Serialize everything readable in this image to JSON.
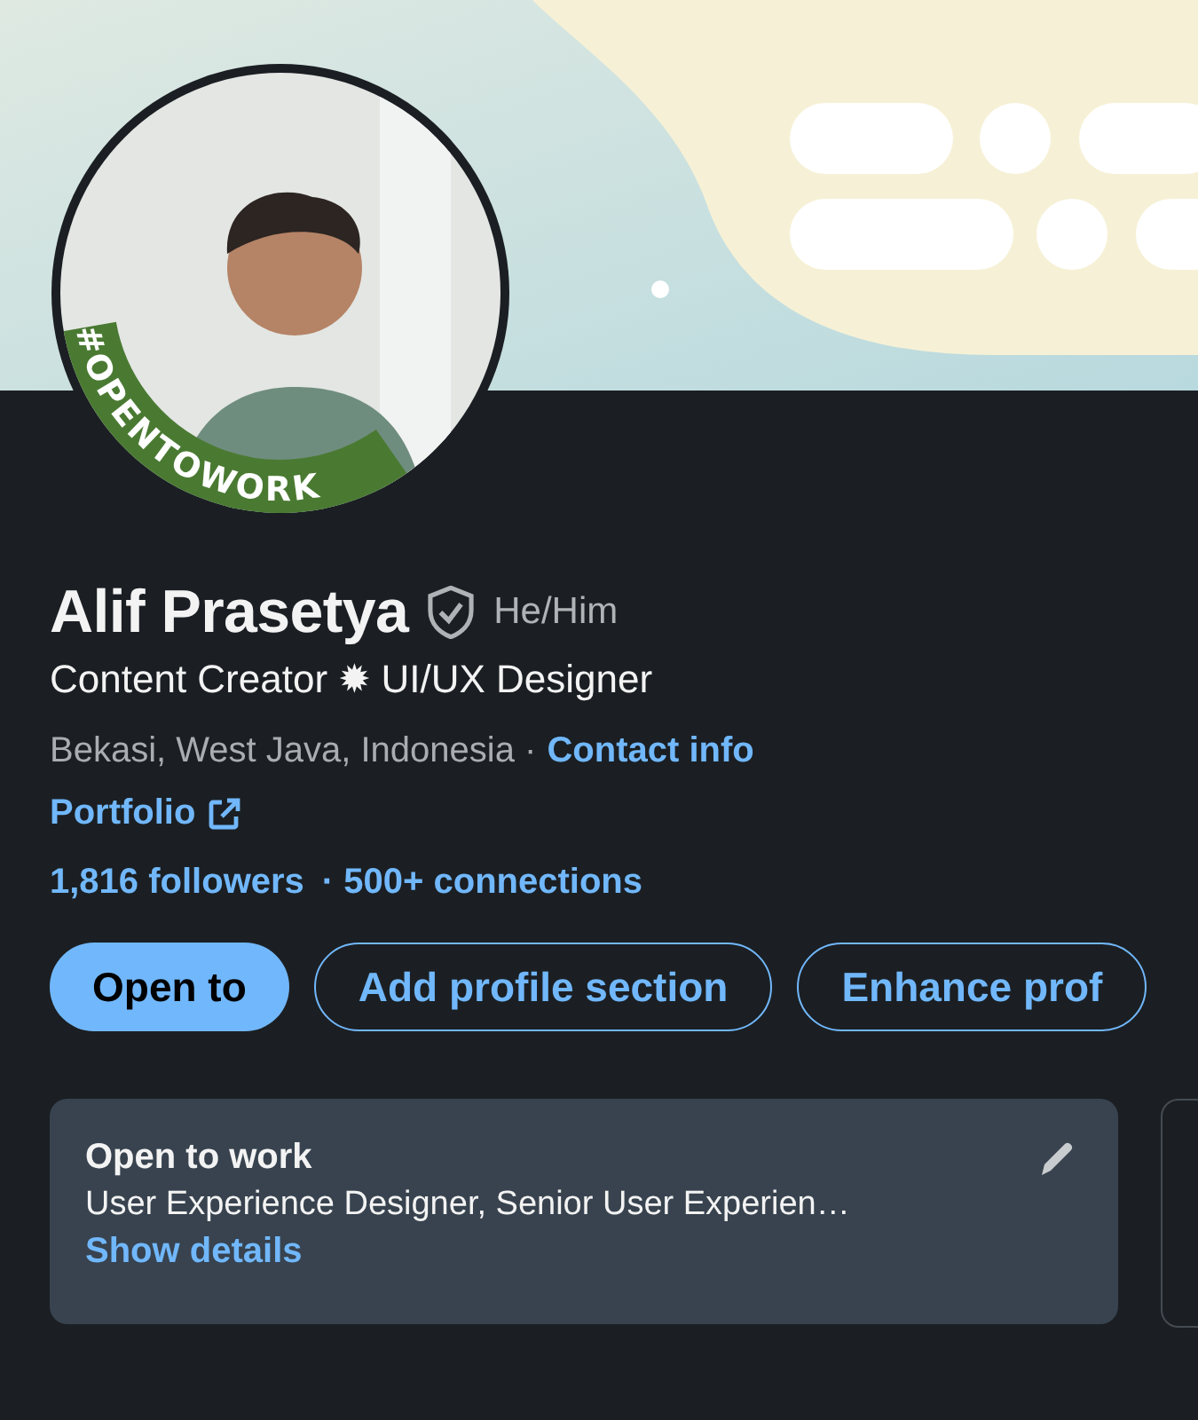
{
  "avatar": {
    "kind": "picture",
    "badge": "#OPENTOWORK"
  },
  "profile": {
    "name": "Alif Prasetya",
    "verified": true,
    "pronouns": "He/Him",
    "headline": "Content Creator ✹ UI/UX Designer",
    "location": "Bekasi, West Java, Indonesia ·",
    "contact_link": "Contact info",
    "portfolio_link": "Portfolio",
    "stats": [
      {
        "text": "1,816 followers"
      },
      {
        "text": "· 500+ connections"
      }
    ]
  },
  "actions": [
    {
      "label": "Open to",
      "kind": "primary"
    },
    {
      "label": "Add profile section",
      "kind": "outline"
    },
    {
      "label": "Enhance prof",
      "kind": "outline"
    }
  ],
  "open_to_work_card": {
    "title": "Open to work",
    "roles": "User Experience Designer, Senior User Experien…",
    "link": "Show details",
    "editable": true
  }
}
